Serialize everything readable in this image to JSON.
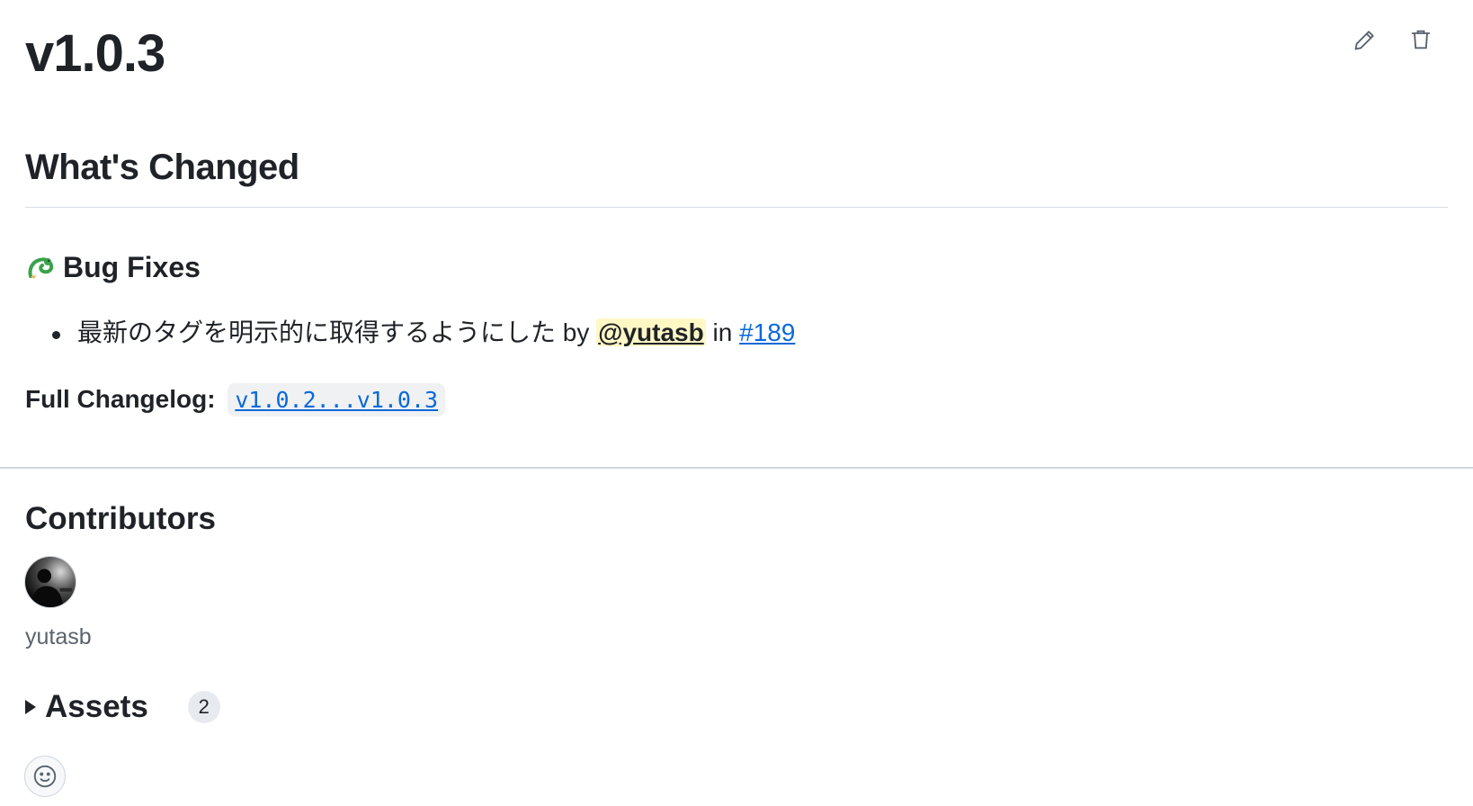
{
  "release": {
    "title": "v1.0.3",
    "actions": {
      "edit_icon": "pencil-icon",
      "delete_icon": "trash-icon"
    }
  },
  "changes": {
    "heading": "What's Changed",
    "section_heading": "Bug Fixes",
    "section_icon": "dragon-emoji-icon",
    "items": [
      {
        "text": "最新のタグを明示的に取得するようにした",
        "by": "by",
        "author": "@yutasb",
        "in": "in",
        "pr": "#189"
      }
    ],
    "changelog_label": "Full Changelog:",
    "changelog_link": "v1.0.2...v1.0.3"
  },
  "contributors": {
    "heading": "Contributors",
    "users": [
      {
        "name": "yutasb"
      }
    ]
  },
  "assets": {
    "heading": "Assets",
    "count": "2"
  },
  "reactions": {
    "icon": "smiley-icon"
  },
  "colors": {
    "text": "#1f2328",
    "link": "#0969da",
    "mention_bg": "#fff8c5",
    "muted": "#59636e",
    "divider": "#d0d7de"
  }
}
